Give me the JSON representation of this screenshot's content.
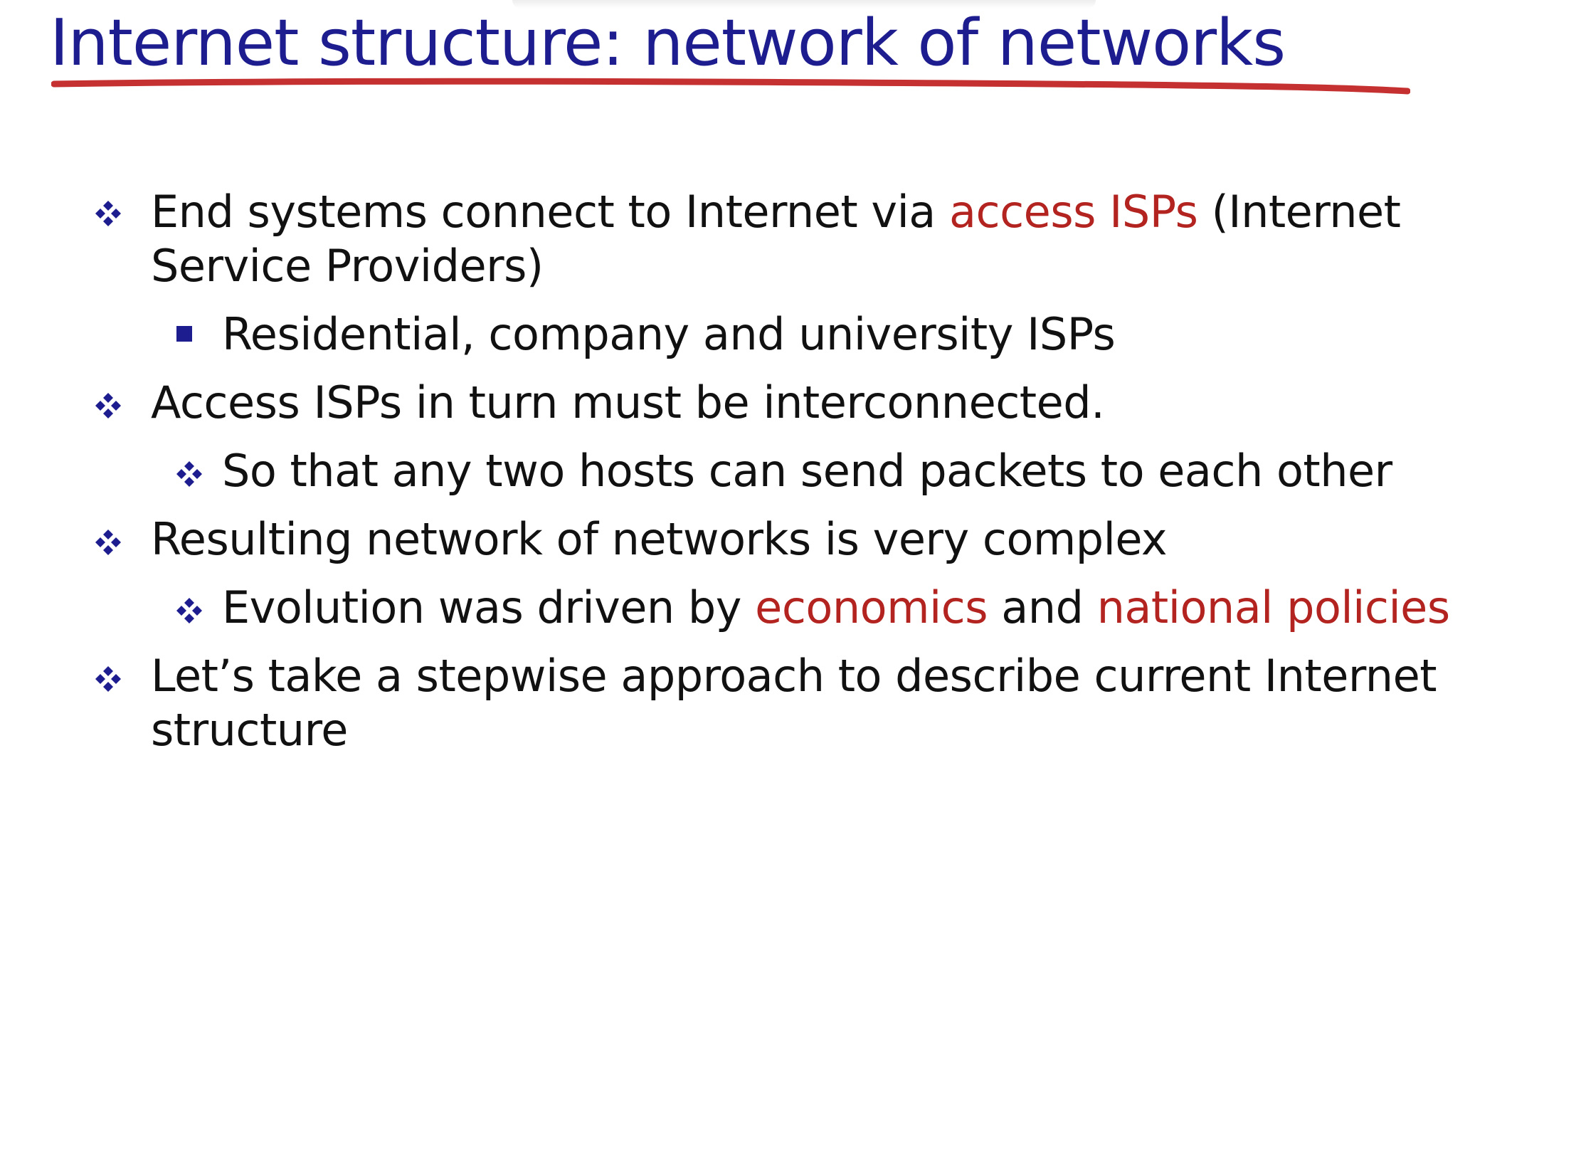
{
  "slide": {
    "title": "Internet structure: network of networks",
    "colors": {
      "title": "#1d1d8f",
      "underline": "#c53030",
      "highlight": "#b3231f",
      "body_text": "#111111",
      "bullet": "#1d1d8f"
    },
    "bullets": [
      {
        "level": 1,
        "marker": "four-diamond-icon",
        "pre": "End systems connect to Internet via ",
        "highlight": "access ISPs",
        "post": " (Internet Service Providers)"
      },
      {
        "level": 2,
        "marker": "square-bullet-icon",
        "text": "Residential, company and university ISPs"
      },
      {
        "level": 1,
        "marker": "four-diamond-icon",
        "text": "Access ISPs in turn must be interconnected."
      },
      {
        "level": 2,
        "marker": "four-diamond-icon",
        "text": "So that any two hosts can send packets to each other"
      },
      {
        "level": 1,
        "marker": "four-diamond-icon",
        "text": "Resulting network of networks is very complex"
      },
      {
        "level": 2,
        "marker": "four-diamond-icon",
        "pre": "Evolution was driven by ",
        "highlight1": "economics",
        "mid": " and ",
        "highlight2": "national policies"
      },
      {
        "level": 1,
        "marker": "four-diamond-icon",
        "text": "Let’s take a stepwise approach to describe current Internet structure"
      }
    ]
  }
}
